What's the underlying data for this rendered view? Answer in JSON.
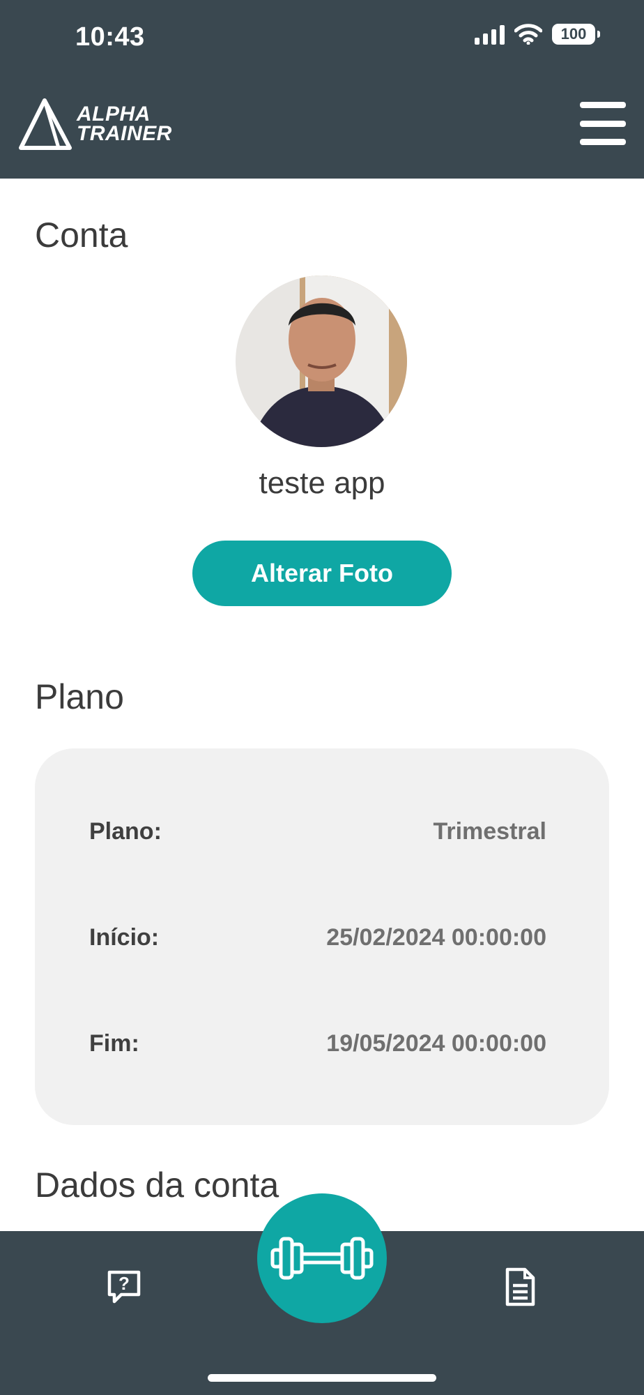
{
  "status_bar": {
    "time": "10:43",
    "battery": "100"
  },
  "header": {
    "logo_line1": "ALPHA",
    "logo_line2": "TRAINER",
    "menu_icon": "hamburger-menu-icon"
  },
  "account": {
    "title": "Conta",
    "username": "teste app",
    "change_photo_label": "Alterar Foto"
  },
  "plan": {
    "title": "Plano",
    "rows": [
      {
        "label": "Plano:",
        "value": "Trimestral"
      },
      {
        "label": "Início:",
        "value": "25/02/2024 00:00:00"
      },
      {
        "label": "Fim:",
        "value": "19/05/2024 00:00:00"
      }
    ]
  },
  "account_data": {
    "title": "Dados da conta"
  },
  "bottom_nav": {
    "left_icon": "help-chat-icon",
    "center_icon": "dumbbell-icon",
    "right_icon": "document-icon"
  },
  "colors": {
    "header_bg": "#3a4850",
    "accent": "#0fa7a4",
    "card_bg": "#f1f1f1"
  }
}
